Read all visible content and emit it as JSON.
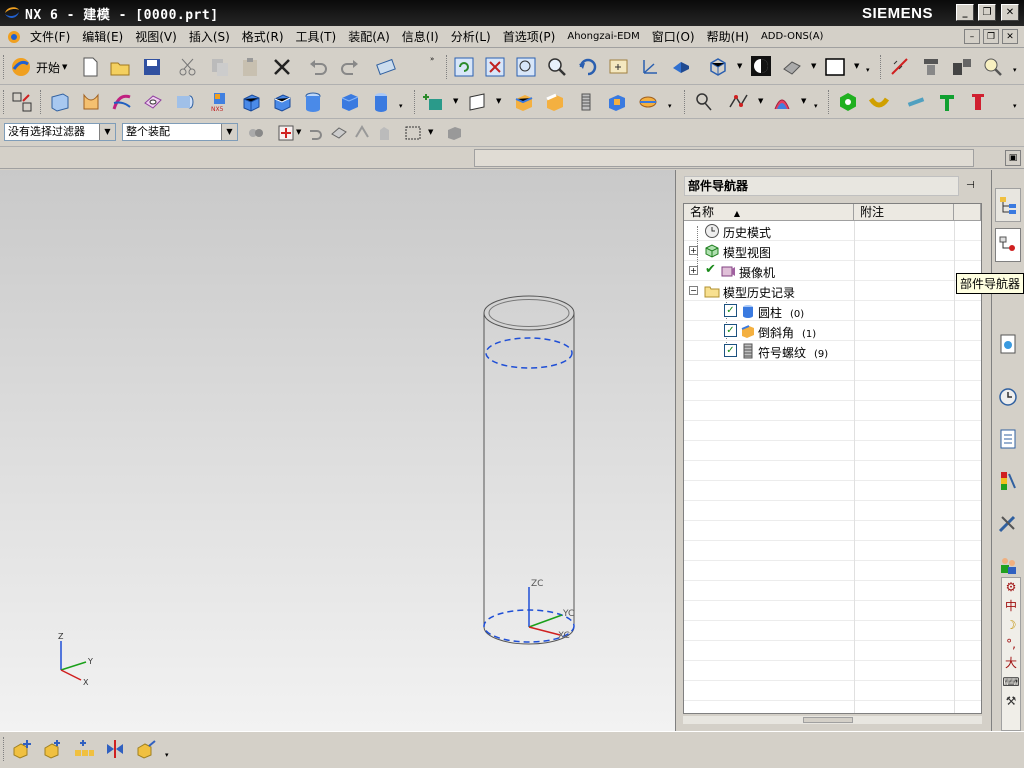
{
  "titlebar": {
    "title": "NX 6 - 建模 - [0000.prt]",
    "brand": "SIEMENS"
  },
  "menu": {
    "items": [
      {
        "label": "文件(F)",
        "name": "menu-file"
      },
      {
        "label": "编辑(E)",
        "name": "menu-edit"
      },
      {
        "label": "视图(V)",
        "name": "menu-view"
      },
      {
        "label": "插入(S)",
        "name": "menu-insert"
      },
      {
        "label": "格式(R)",
        "name": "menu-format"
      },
      {
        "label": "工具(T)",
        "name": "menu-tools"
      },
      {
        "label": "装配(A)",
        "name": "menu-assembly"
      },
      {
        "label": "信息(I)",
        "name": "menu-info"
      },
      {
        "label": "分析(L)",
        "name": "menu-analysis"
      },
      {
        "label": "首选项(P)",
        "name": "menu-preferences"
      },
      {
        "label": "Ahongzai-EDM",
        "name": "menu-ahongzai-edm"
      },
      {
        "label": "窗口(O)",
        "name": "menu-window"
      },
      {
        "label": "帮助(H)",
        "name": "menu-help"
      },
      {
        "label": "ADD-ONS(A)",
        "name": "menu-addons"
      }
    ]
  },
  "toolbar": {
    "start_label": "开始",
    "nx5_badge": "NX5"
  },
  "selection": {
    "filter_value": "没有选择过滤器",
    "scope_value": "整个装配"
  },
  "viewport": {
    "axis_zc": "ZC",
    "axis_yc": "YC",
    "axis_xc": "XC",
    "triad_z": "Z",
    "triad_y": "Y",
    "triad_x": "X"
  },
  "navigator": {
    "title": "部件导航器",
    "col_name": "名称",
    "col_note": "附注",
    "rows": [
      {
        "label": "历史模式",
        "count": ""
      },
      {
        "label": "模型视图",
        "count": ""
      },
      {
        "label": "摄像机",
        "count": ""
      },
      {
        "label": "模型历史记录",
        "count": ""
      },
      {
        "label": "圆柱",
        "count": "(0)"
      },
      {
        "label": "倒斜角",
        "count": "(1)"
      },
      {
        "label": "符号螺纹",
        "count": "(9)"
      }
    ]
  },
  "tooltip": {
    "text": "部件导航器"
  },
  "ime": {
    "chars": [
      "中",
      "°,",
      "大"
    ]
  },
  "colors": {
    "accent_blue": "#1f4fd6",
    "check_green": "#1a8a1a",
    "title_bg": "#0a0a0a"
  }
}
